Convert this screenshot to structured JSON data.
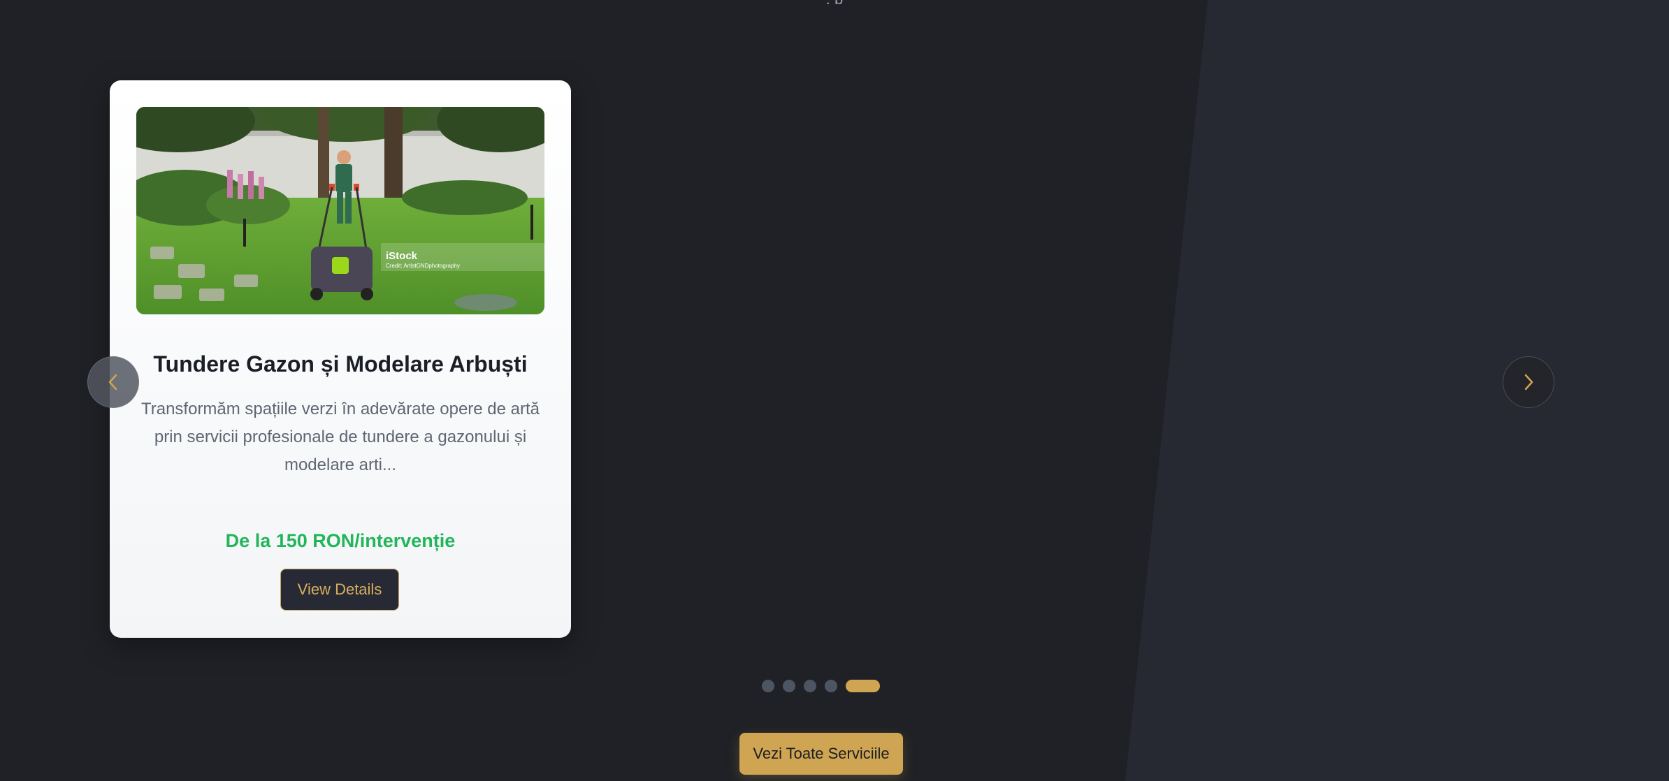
{
  "page": {
    "top_partial_text": ", p",
    "colors": {
      "background": "#1f2126",
      "accent_gold": "#cfa553",
      "price_green": "#22b55a"
    }
  },
  "carousel": {
    "card": {
      "image_alt": "Gardener mowing lawn",
      "watermark_brand": "iStock",
      "watermark_credit": "Credit: ArtistGNDphotography",
      "title": "Tundere Gazon și Modelare Arbuști",
      "description": "Transformăm spațiile verzi în adevărate opere de artă prin servicii profesionale de tundere a gazonului și modelare arti...",
      "price": "De la 150 RON/intervenție",
      "button_label": "View Details"
    },
    "prev_icon": "chevron-left-icon",
    "next_icon": "chevron-right-icon",
    "dots_total": 5,
    "active_dot": 5
  },
  "cta": {
    "label": "Vezi Toate Serviciile"
  }
}
